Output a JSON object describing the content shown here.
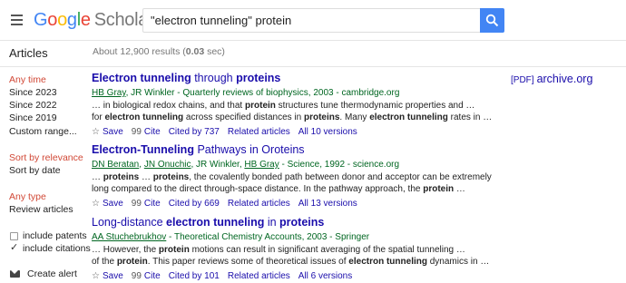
{
  "header": {
    "logo_google": [
      "G",
      "o",
      "o",
      "g",
      "l",
      "e"
    ],
    "logo_scholar": "Scholar",
    "search_value": "\"electron tunneling\" protein"
  },
  "sidebar": {
    "title": "Articles",
    "time_filters": [
      "Any time",
      "Since 2023",
      "Since 2022",
      "Since 2019",
      "Custom range..."
    ],
    "sort_options": [
      "Sort by relevance",
      "Sort by date"
    ],
    "type_options": [
      "Any type",
      "Review articles"
    ],
    "include_patents": "include patents",
    "include_citations": "include citations",
    "create_alert": "Create alert"
  },
  "results_stats": {
    "prefix": "About 12,900 results (",
    "time": "0.03",
    "suffix": " sec)"
  },
  "results": [
    {
      "title_parts": [
        {
          "t": "Electron tunneling",
          "b": true
        },
        {
          "t": " through ",
          "b": false
        },
        {
          "t": "proteins",
          "b": true
        }
      ],
      "authors": [
        {
          "t": "HB Gray",
          "u": true
        },
        {
          "t": ", JR Winkler - Quarterly reviews of biophysics, 2003 - cambridge.org",
          "u": false
        }
      ],
      "snippet_lines": [
        [
          {
            "t": "… in biological redox chains, and that ",
            "b": false
          },
          {
            "t": "protein",
            "b": true
          },
          {
            "t": " structures tune thermodynamic properties and …",
            "b": false
          }
        ],
        [
          {
            "t": "for ",
            "b": false
          },
          {
            "t": "electron tunneling",
            "b": true
          },
          {
            "t": " across specified distances in ",
            "b": false
          },
          {
            "t": "proteins",
            "b": true
          },
          {
            "t": ". Many ",
            "b": false
          },
          {
            "t": "electron tunneling",
            "b": true
          },
          {
            "t": " rates in …",
            "b": false
          }
        ]
      ],
      "actions": {
        "save": "Save",
        "cite": "Cite",
        "cited_by": "Cited by 737",
        "related": "Related articles",
        "versions": "All 10 versions"
      }
    },
    {
      "title_parts": [
        {
          "t": "Electron-Tunneling",
          "b": true
        },
        {
          "t": " Pathways in Oroteins",
          "b": false
        }
      ],
      "authors": [
        {
          "t": "DN Beratan",
          "u": true
        },
        {
          "t": ", ",
          "u": false
        },
        {
          "t": "JN Onuchic",
          "u": true
        },
        {
          "t": ", JR Winkler, ",
          "u": false
        },
        {
          "t": "HB Gray",
          "u": true
        },
        {
          "t": " - Science, 1992 - science.org",
          "u": false
        }
      ],
      "snippet_lines": [
        [
          {
            "t": "… ",
            "b": false
          },
          {
            "t": "proteins",
            "b": true
          },
          {
            "t": " … ",
            "b": false
          },
          {
            "t": "proteins",
            "b": true
          },
          {
            "t": ", the covalently bonded path between donor and acceptor can be extremely",
            "b": false
          }
        ],
        [
          {
            "t": "long compared to the direct through-space distance. In the pathway approach, the ",
            "b": false
          },
          {
            "t": "protein",
            "b": true
          },
          {
            "t": " …",
            "b": false
          }
        ]
      ],
      "actions": {
        "save": "Save",
        "cite": "Cite",
        "cited_by": "Cited by 669",
        "related": "Related articles",
        "versions": "All 13 versions"
      }
    },
    {
      "title_parts": [
        {
          "t": "Long-distance ",
          "b": false
        },
        {
          "t": "electron tunneling",
          "b": true
        },
        {
          "t": " in ",
          "b": false
        },
        {
          "t": "proteins",
          "b": true
        }
      ],
      "authors": [
        {
          "t": "AA Stuchebrukhov",
          "u": true
        },
        {
          "t": " - Theoretical Chemistry Accounts, 2003 - Springer",
          "u": false
        }
      ],
      "snippet_lines": [
        [
          {
            "t": "… However, the ",
            "b": false
          },
          {
            "t": "protein",
            "b": true
          },
          {
            "t": " motions can result in significant averaging of the spatial tunneling …",
            "b": false
          }
        ],
        [
          {
            "t": "of the ",
            "b": false
          },
          {
            "t": "protein",
            "b": true
          },
          {
            "t": ". This paper reviews some of theoretical issues of ",
            "b": false
          },
          {
            "t": "electron tunneling",
            "b": true
          },
          {
            "t": " dynamics in …",
            "b": false
          }
        ]
      ],
      "actions": {
        "save": "Save",
        "cite": "Cite",
        "cited_by": "Cited by 101",
        "related": "Related articles",
        "versions": "All 6 versions"
      }
    }
  ],
  "pdf_link": {
    "tag": "[PDF]",
    "domain": "archive.org"
  },
  "icons": {
    "star": "☆",
    "quote": "99"
  },
  "colors": {
    "link": "#1a0dab",
    "green": "#006621",
    "red": "#d14836",
    "blue": "#4285f4"
  }
}
